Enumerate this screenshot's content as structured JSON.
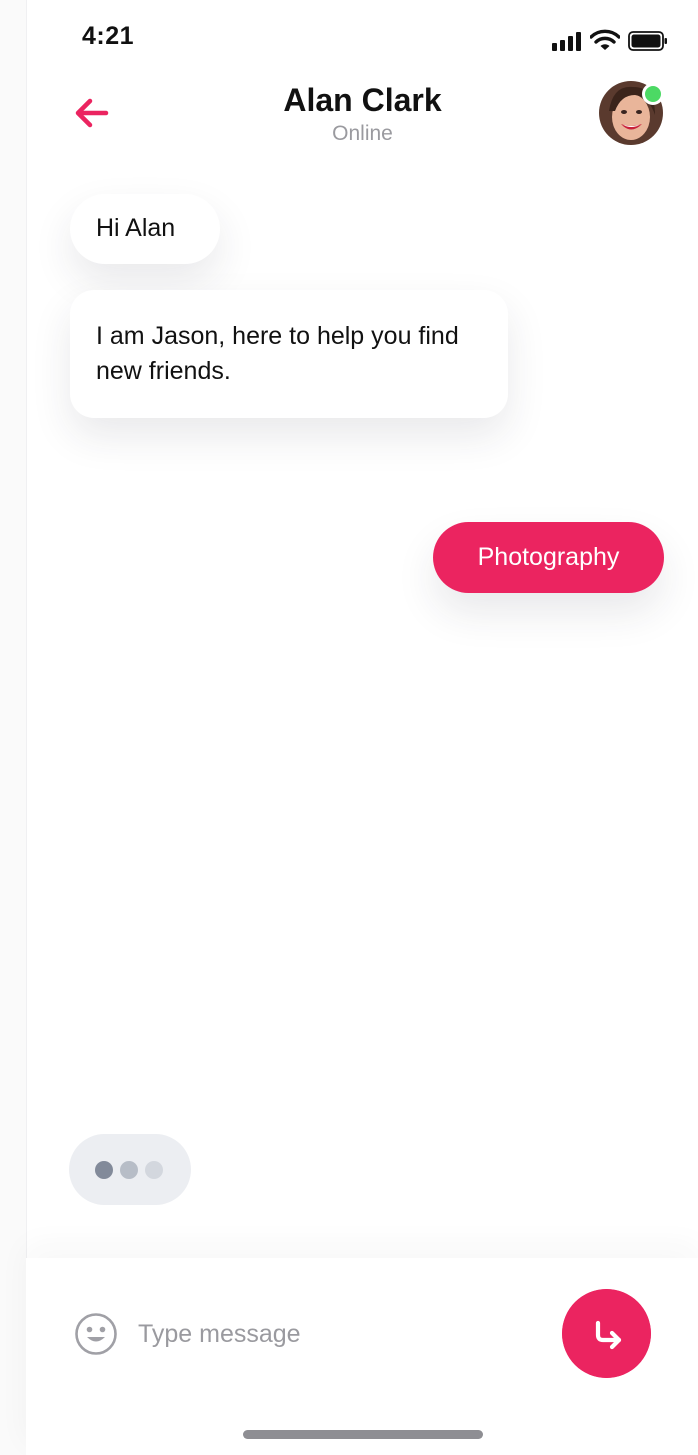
{
  "status_bar": {
    "time": "4:21",
    "signal_icon": "cellular-signal-icon",
    "wifi_icon": "wifi-icon",
    "battery_icon": "battery-icon"
  },
  "header": {
    "back_icon": "arrow-left-icon",
    "contact_name": "Alan Clark",
    "contact_status": "Online",
    "avatar_icon": "contact-avatar",
    "online_indicator": "online-dot"
  },
  "messages": [
    {
      "direction": "incoming",
      "text": "Hi Alan"
    },
    {
      "direction": "incoming",
      "text": "I am Jason, here to help you find new friends."
    },
    {
      "direction": "outgoing",
      "text": "Photography"
    }
  ],
  "typing_indicator": {
    "dots": 3
  },
  "composer": {
    "emoji_icon": "smiley-icon",
    "placeholder": "Type message",
    "value": "",
    "send_icon": "send-arrow-icon"
  },
  "colors": {
    "accent": "#eb2460",
    "online": "#4cd964",
    "muted_text": "#9a9a9f",
    "typing_bg": "#eceef2"
  }
}
